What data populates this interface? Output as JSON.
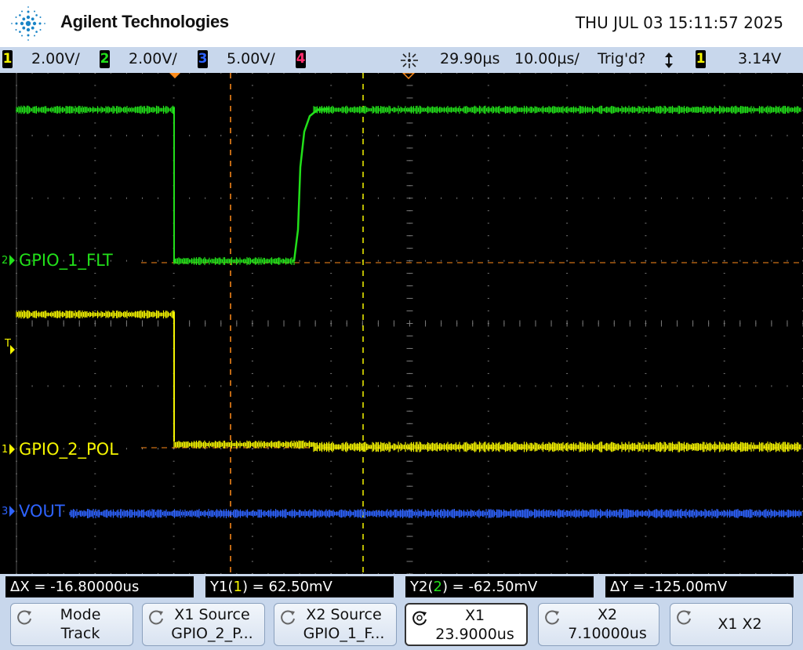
{
  "header": {
    "brand": "Agilent Technologies",
    "datetime": "THU JUL 03 15:11:57 2025",
    "logo_icon": "agilent-spark-icon"
  },
  "status_bar": {
    "ch1": {
      "num": "1",
      "scale": "2.00V/",
      "color": "#f5f500"
    },
    "ch2": {
      "num": "2",
      "scale": "2.00V/",
      "color": "#22e01a"
    },
    "ch3": {
      "num": "3",
      "scale": "5.00V/",
      "color": "#2e63ff"
    },
    "ch4": {
      "num": "4",
      "color": "#ff2d6e"
    },
    "delay_icon": "time-reference-icon",
    "delay": "29.90µs",
    "timebase": "10.00µs/",
    "trigger_status": "Trig'd?",
    "trigger_edge_icon": "trigger-edge-icon",
    "trigger_source": "1",
    "trigger_level": "3.14V"
  },
  "traces": {
    "ch2_label": "GPIO_1_FLT",
    "ch1_label": "GPIO_2_POL",
    "ch3_label": "VOUT",
    "ch2_marker": "2",
    "ch1_marker": "1",
    "ch3_marker": "3",
    "trigger_marker": "T",
    "colors": {
      "ch1": "#f5f500",
      "ch2": "#22e01a",
      "ch3": "#2e63ff",
      "cursor": "#ff8c1a",
      "grid": "#7a7a7a"
    }
  },
  "measurements": {
    "delta_x": "ΔX = -16.80000us",
    "y1_prefix": "Y1(",
    "y1_num": "1",
    "y1_suffix": ") = 62.50mV",
    "y2_prefix": "Y2(",
    "y2_num": "2",
    "y2_suffix": ") = -62.50mV",
    "delta_y": "ΔY = -125.00mV"
  },
  "softkeys": [
    {
      "line1": "Mode",
      "line2": "Track"
    },
    {
      "line1": "X1 Source",
      "line2": "GPIO_2_P..."
    },
    {
      "line1": "X2 Source",
      "line2": "GPIO_1_F..."
    },
    {
      "line1": "X1",
      "line2": "23.9000us"
    },
    {
      "line1": "X2",
      "line2": "7.10000us"
    },
    {
      "line1": "X1 X2",
      "line2": ""
    }
  ]
}
